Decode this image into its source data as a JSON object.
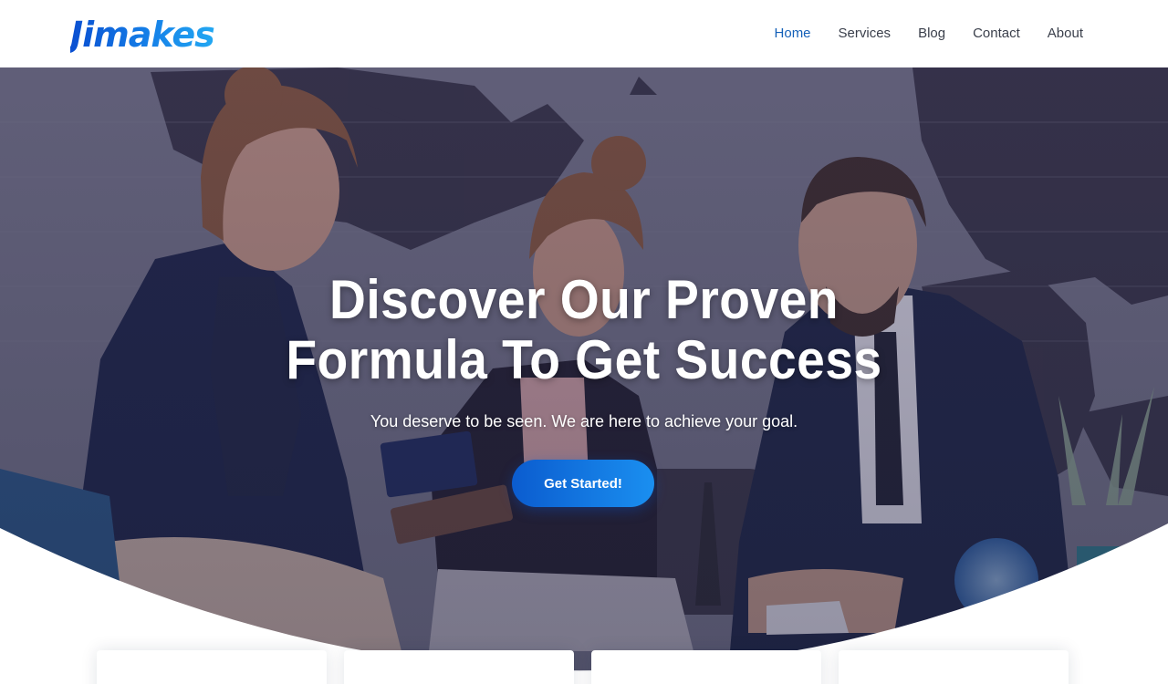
{
  "brand": {
    "logo_text": "Jimakes"
  },
  "nav": {
    "items": [
      {
        "label": "Home",
        "active": true
      },
      {
        "label": "Services",
        "active": false
      },
      {
        "label": "Blog",
        "active": false
      },
      {
        "label": "Contact",
        "active": false
      },
      {
        "label": "About",
        "active": false
      }
    ]
  },
  "hero": {
    "title_line1": "Discover Our Proven",
    "title_line2": "Formula To Get Success",
    "subtitle": "You deserve to be seen. We are here to achieve your goal.",
    "cta_label": "Get Started!",
    "background_image": "business-team-meeting-photo"
  },
  "colors": {
    "brand_blue": "#0a4fd1",
    "brand_light_blue": "#23a8f2",
    "nav_active": "#1460b8",
    "nav_text": "#3a3f4b",
    "cta_start": "#0b5ccf",
    "cta_end": "#1a8ff0"
  }
}
